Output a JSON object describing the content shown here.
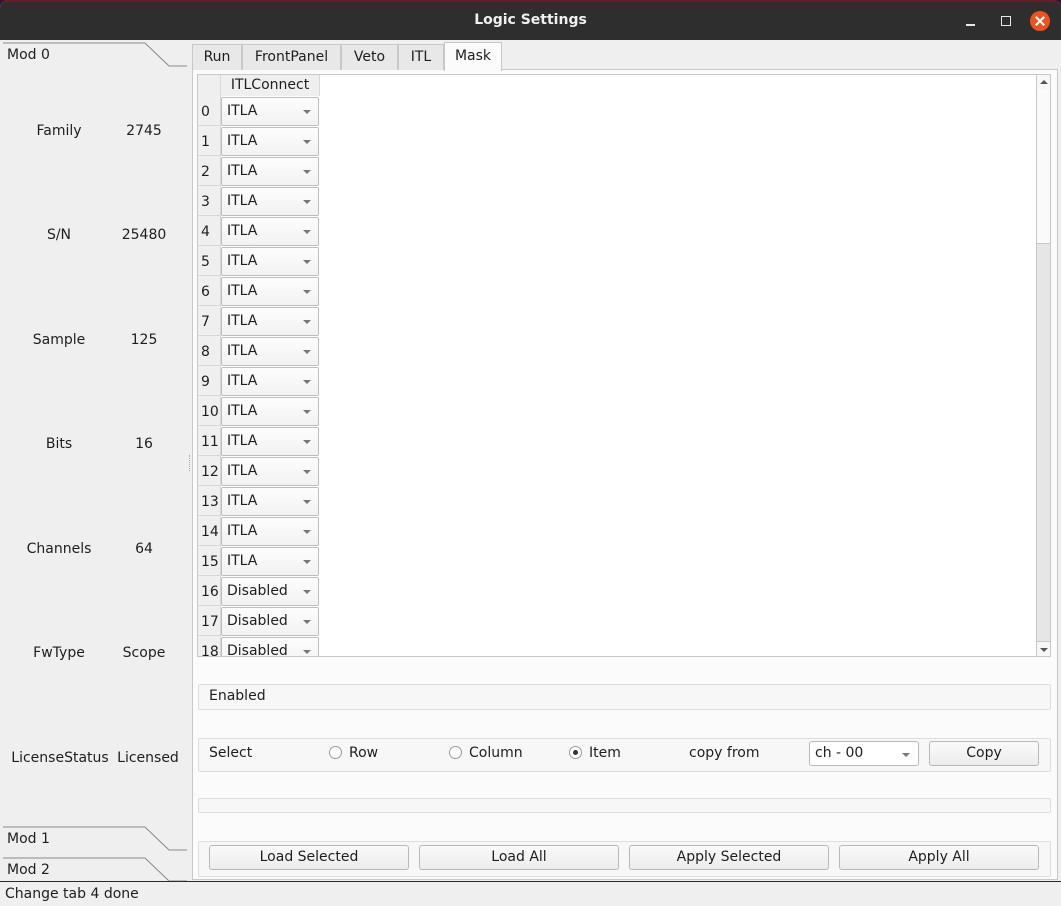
{
  "window": {
    "title": "Logic Settings",
    "controls": [
      "minimize-icon",
      "maximize-icon",
      "close-icon"
    ]
  },
  "toolbox": {
    "sections": [
      {
        "label": "Mod 0",
        "expanded": true
      },
      {
        "label": "Mod 1",
        "expanded": false
      },
      {
        "label": "Mod 2",
        "expanded": false
      }
    ],
    "info": [
      {
        "label": "Family",
        "value": "2745"
      },
      {
        "label": "S/N",
        "value": "25480"
      },
      {
        "label": "Sample",
        "value": "125"
      },
      {
        "label": "Bits",
        "value": "16"
      },
      {
        "label": "Channels",
        "value": "64"
      },
      {
        "label": "FwType",
        "value": "Scope"
      },
      {
        "label": "LicenseStatus",
        "value": "Licensed"
      }
    ]
  },
  "tabs": [
    {
      "label": "Run",
      "active": false
    },
    {
      "label": "FrontPanel",
      "active": false
    },
    {
      "label": "Veto",
      "active": false
    },
    {
      "label": "ITL",
      "active": false
    },
    {
      "label": "Mask",
      "active": true
    }
  ],
  "table": {
    "columns": [
      "ITLConnect"
    ],
    "rows": [
      {
        "index": "0",
        "value": "ITLA"
      },
      {
        "index": "1",
        "value": "ITLA"
      },
      {
        "index": "2",
        "value": "ITLA"
      },
      {
        "index": "3",
        "value": "ITLA"
      },
      {
        "index": "4",
        "value": "ITLA"
      },
      {
        "index": "5",
        "value": "ITLA"
      },
      {
        "index": "6",
        "value": "ITLA"
      },
      {
        "index": "7",
        "value": "ITLA"
      },
      {
        "index": "8",
        "value": "ITLA"
      },
      {
        "index": "9",
        "value": "ITLA"
      },
      {
        "index": "10",
        "value": "ITLA"
      },
      {
        "index": "11",
        "value": "ITLA"
      },
      {
        "index": "12",
        "value": "ITLA"
      },
      {
        "index": "13",
        "value": "ITLA"
      },
      {
        "index": "14",
        "value": "ITLA"
      },
      {
        "index": "15",
        "value": "ITLA"
      },
      {
        "index": "16",
        "value": "Disabled"
      },
      {
        "index": "17",
        "value": "Disabled"
      },
      {
        "index": "18",
        "value": "Disabled"
      }
    ],
    "scroll_position": 0.0
  },
  "enabled_box": {
    "label": "Enabled"
  },
  "select_bar": {
    "label": "Select",
    "options": [
      {
        "label": "Row",
        "checked": false
      },
      {
        "label": "Column",
        "checked": false
      },
      {
        "label": "Item",
        "checked": true
      }
    ],
    "copy_from_label": "copy from",
    "copy_from_value": "ch - 00",
    "copy_button": "Copy"
  },
  "actions": {
    "load_selected": "Load Selected",
    "load_all": "Load All",
    "apply_selected": "Apply Selected",
    "apply_all": "Apply All"
  },
  "status": {
    "text": "Change tab 4 done"
  }
}
